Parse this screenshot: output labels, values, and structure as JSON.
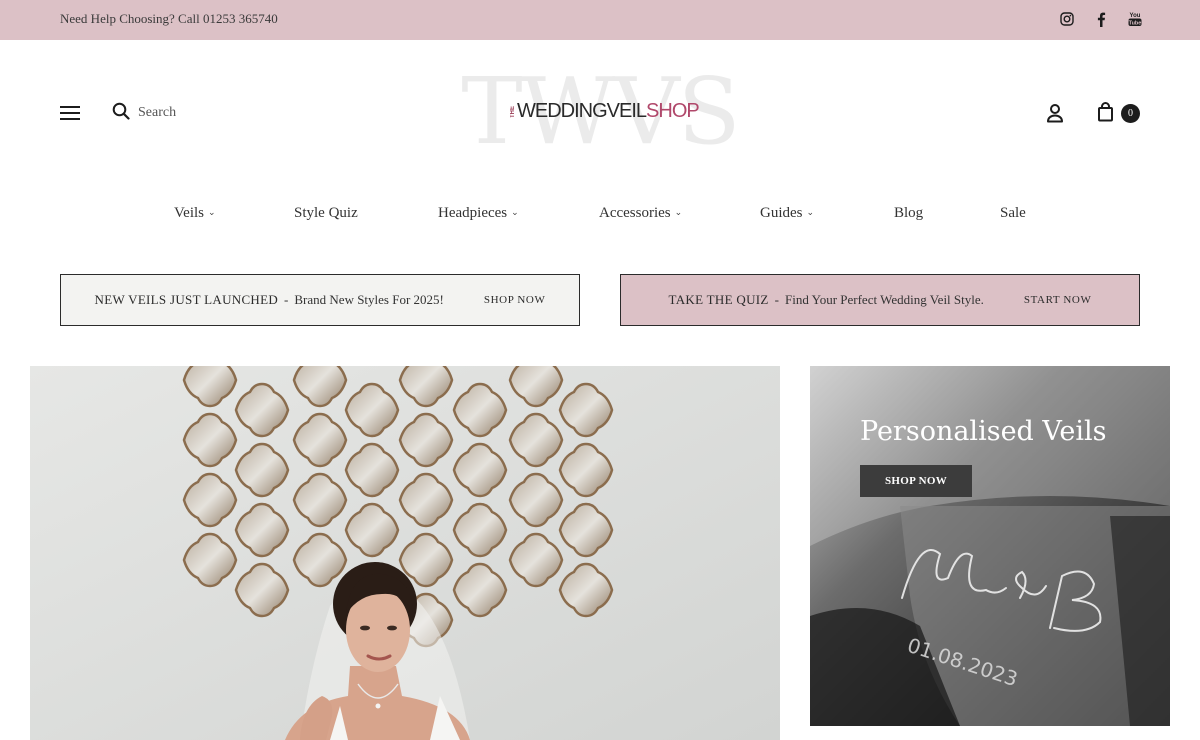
{
  "topbar": {
    "help_text": "Need Help Choosing? Call 01253 365740",
    "social_icons": [
      "instagram-icon",
      "facebook-icon",
      "youtube-icon"
    ]
  },
  "header": {
    "search_label": "Search",
    "logo": {
      "monogram": "TWVS",
      "the": "THE",
      "part1": "WEDDINGVEIL",
      "part2": "SHOP"
    },
    "cart_count": "0"
  },
  "nav": [
    {
      "label": "Veils",
      "dropdown": true
    },
    {
      "label": "Style Quiz",
      "dropdown": false
    },
    {
      "label": "Headpieces",
      "dropdown": true
    },
    {
      "label": "Accessories",
      "dropdown": true
    },
    {
      "label": "Guides",
      "dropdown": true
    },
    {
      "label": "Blog",
      "dropdown": false
    },
    {
      "label": "Sale",
      "dropdown": false
    }
  ],
  "promos": [
    {
      "title": "NEW VEILS JUST LAUNCHED",
      "separator": "-",
      "subtitle": "Brand New Styles For 2025!",
      "cta": "SHOP NOW"
    },
    {
      "title": "TAKE THE QUIZ",
      "separator": "-",
      "subtitle": "Find Your Perfect Wedding Veil Style.",
      "cta": "START NOW"
    }
  ],
  "hero_side": {
    "title": "Personalised Veils",
    "cta": "SHOP NOW",
    "embroidery": "M & B",
    "embroidery_date": "01.08.2023"
  },
  "colors": {
    "topbar_bg": "#dcc1c6",
    "brand_accent": "#b0476a",
    "promo_left_bg": "#f3f3f1",
    "promo_right_bg": "#dcc1c6"
  }
}
